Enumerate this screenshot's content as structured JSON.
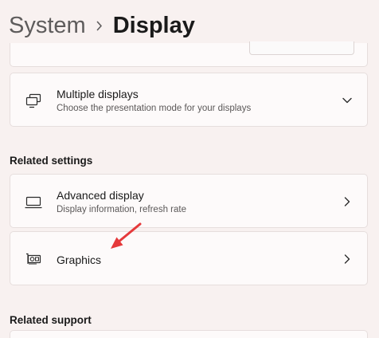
{
  "breadcrumb": {
    "parent": "System",
    "current": "Display"
  },
  "multiple_displays": {
    "title": "Multiple displays",
    "subtitle": "Choose the presentation mode for your displays",
    "icon": "multiple-displays-icon",
    "expander": "chevron-down-icon"
  },
  "related_settings": {
    "heading": "Related settings",
    "items": [
      {
        "title": "Advanced display",
        "subtitle": "Display information, refresh rate",
        "icon": "monitor-icon"
      },
      {
        "title": "Graphics",
        "icon": "graphics-card-icon"
      }
    ]
  },
  "related_support": {
    "heading": "Related support"
  },
  "colors": {
    "background": "#f8f1f0",
    "card": "#fdfafa",
    "annotation_arrow": "#e5393b"
  }
}
